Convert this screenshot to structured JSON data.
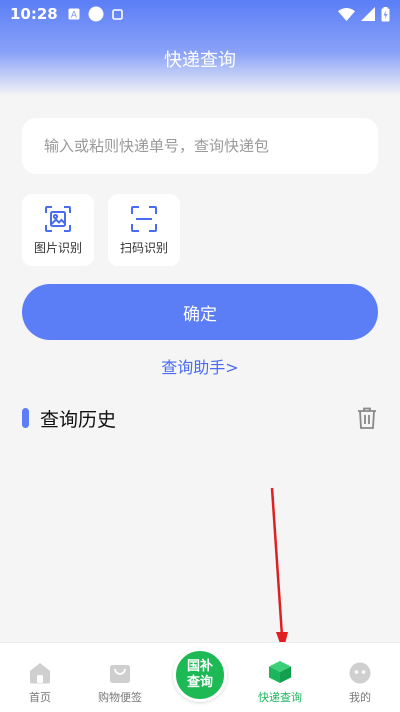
{
  "status": {
    "time": "10:28"
  },
  "header": {
    "title": "快递查询"
  },
  "search": {
    "placeholder": "输入或粘则快递单号，查询快递包"
  },
  "tools": [
    {
      "label": "图片识别",
      "icon": "image-scan-icon"
    },
    {
      "label": "扫码识别",
      "icon": "scan-frame-icon"
    }
  ],
  "confirm": {
    "label": "确定"
  },
  "helper": {
    "label": "查询助手>"
  },
  "history": {
    "title": "查询历史",
    "icon": "trash-icon"
  },
  "tabs": [
    {
      "label": "首页",
      "icon": "home-icon"
    },
    {
      "label": "购物便签",
      "icon": "shopping-bag-icon"
    },
    {
      "label_line1": "国补",
      "label_line2": "查询"
    },
    {
      "label": "快递查询",
      "icon": "package-icon"
    },
    {
      "label": "我的",
      "icon": "profile-icon"
    }
  ],
  "colors": {
    "primary": "#5b7ef7",
    "active_tab": "#1bb55c",
    "fab": "#1db954",
    "annotation_arrow": "#e02020"
  }
}
